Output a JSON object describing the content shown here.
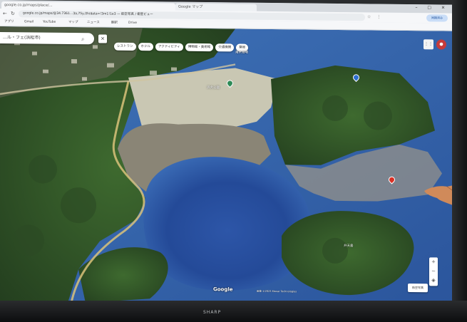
{
  "browser": {
    "tabs": [
      {
        "label": "google.co.jp/maps/place/…",
        "active": true
      },
      {
        "label": "Google マップ",
        "active": false
      }
    ],
    "url": "google.co.jp/maps/@34.7361…3a,75y,0h/data=!3m1!1e3 — 航空写真 / 衛星ビュー",
    "profile_label": "同期済み"
  },
  "bookmarks": [
    "アプリ",
    "Gmail",
    "YouTube",
    "マップ",
    "ニュース",
    "翻訳",
    "Drive"
  ],
  "maps": {
    "search_text": "…ル・フェ(浜松市)",
    "category_chips": [
      "レストラン",
      "ホテル",
      "アクティビティ",
      "博物館・美術館",
      "交通機関",
      "薬局"
    ],
    "labels": [
      "浜名公園",
      "海水浴場",
      "弁天島"
    ],
    "google_mark": "Google",
    "attribution": "画像 ©2023 Maxar Technologies",
    "zoom_in": "+",
    "zoom_out": "−",
    "layers_label": "航空写真"
  },
  "monitor": {
    "brand": "SHARP"
  }
}
